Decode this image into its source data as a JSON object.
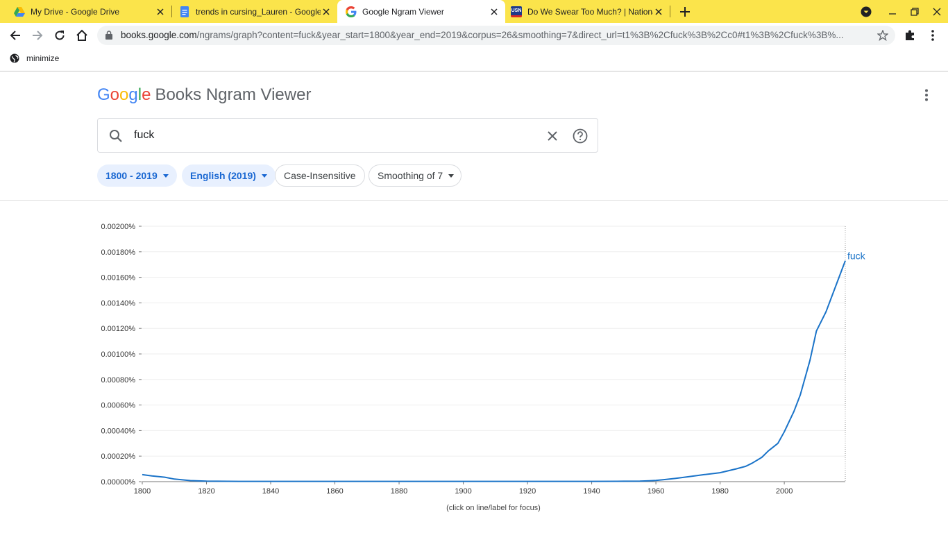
{
  "browser": {
    "tabs": [
      {
        "title": "My Drive - Google Drive",
        "icon": "google-drive-icon",
        "active": false
      },
      {
        "title": "trends in cursing_Lauren - Google Docs",
        "icon": "google-docs-icon",
        "active": false
      },
      {
        "title": "Google Ngram Viewer",
        "icon": "google-g-icon",
        "active": true
      },
      {
        "title": "Do We Swear Too Much? | National",
        "icon": "usn-icon",
        "active": false
      }
    ],
    "url_host": "books.google.com",
    "url_path": "/ngrams/graph?content=fuck&year_start=1800&year_end=2019&corpus=26&smoothing=7&direct_url=t1%3B%2Cfuck%3B%2Cc0#t1%3B%2Cfuck%3B%...",
    "bookmark": "minimize"
  },
  "page": {
    "logo_google": "Google",
    "logo_rest": "Books Ngram Viewer",
    "search_value": "fuck",
    "chips": {
      "years": "1800 - 2019",
      "corpus": "English (2019)",
      "case": "Case-Insensitive",
      "smoothing": "Smoothing of 7"
    },
    "chart_note": "(click on line/label for focus)"
  },
  "colors": {
    "line": "#1a73c8",
    "chip_bg": "#e8f0fe",
    "chip_text": "#1967d2",
    "tabstrip": "#fbe44b"
  },
  "chart_data": {
    "type": "line",
    "title": "",
    "xlabel": "",
    "ylabel": "",
    "xlim": [
      1800,
      2019
    ],
    "ylim": [
      0,
      0.002
    ],
    "y_ticks": [
      "0.00000%",
      "0.00020%",
      "0.00040%",
      "0.00060%",
      "0.00080%",
      "0.00100%",
      "0.00120%",
      "0.00140%",
      "0.00160%",
      "0.00180%",
      "0.00200%"
    ],
    "x_ticks": [
      "1800",
      "1820",
      "1840",
      "1860",
      "1880",
      "1900",
      "1920",
      "1940",
      "1960",
      "1980",
      "2000"
    ],
    "series": [
      {
        "name": "fuck",
        "x": [
          1800,
          1803,
          1807,
          1810,
          1815,
          1820,
          1830,
          1850,
          1900,
          1940,
          1950,
          1955,
          1958,
          1960,
          1963,
          1966,
          1970,
          1975,
          1980,
          1985,
          1988,
          1990,
          1993,
          1995,
          1998,
          2000,
          2003,
          2005,
          2008,
          2010,
          2013,
          2016,
          2019
        ],
        "y": [
          5.5e-05,
          4.5e-05,
          3.5e-05,
          2e-05,
          8e-06,
          4e-06,
          2e-06,
          2e-06,
          2e-06,
          2e-06,
          3e-06,
          4e-06,
          7e-06,
          1e-05,
          1.7e-05,
          2.5e-05,
          3.8e-05,
          5.5e-05,
          7e-05,
          0.0001,
          0.00012,
          0.000145,
          0.00019,
          0.00024,
          0.0003,
          0.00039,
          0.00055,
          0.00068,
          0.00095,
          0.00118,
          0.00133,
          0.00153,
          0.00173
        ]
      }
    ]
  }
}
